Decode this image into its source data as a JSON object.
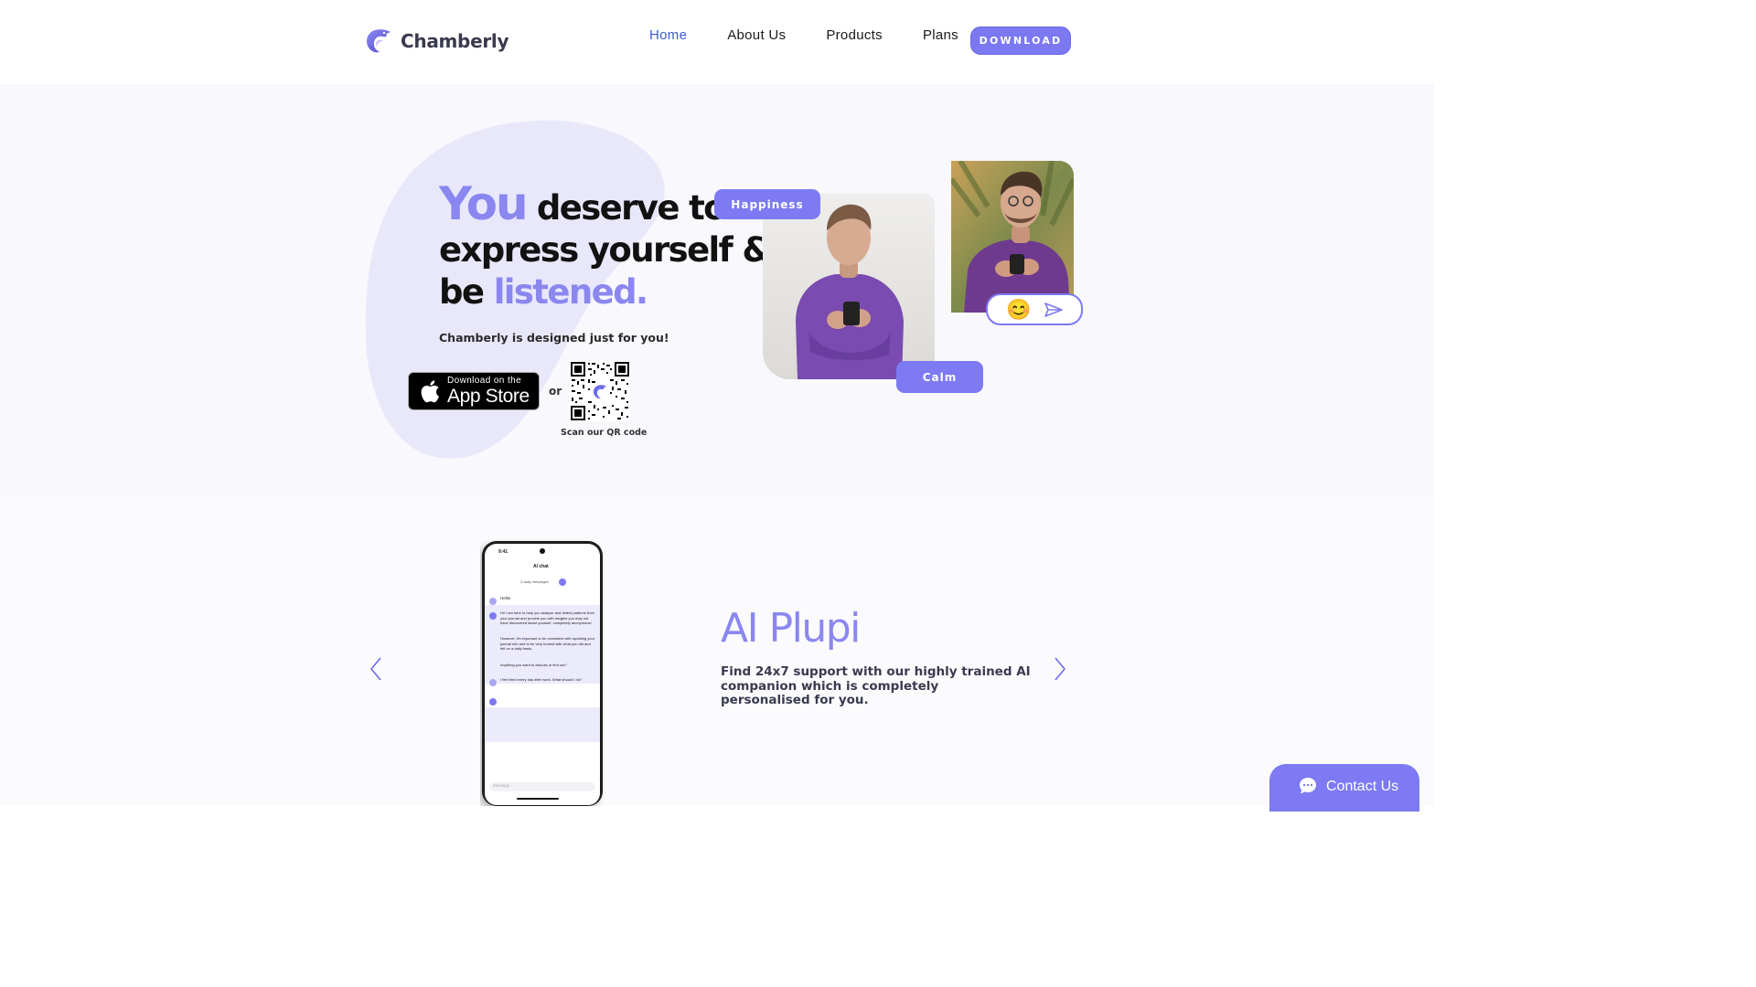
{
  "brand": {
    "name": "Chamberly",
    "logo_icon": "dolphin-logo-icon",
    "accent": "#7d7af3"
  },
  "nav": {
    "items": [
      {
        "label": "Home",
        "active": true
      },
      {
        "label": "About Us",
        "active": false
      },
      {
        "label": "Products",
        "active": false
      },
      {
        "label": "Plans",
        "active": false
      }
    ],
    "download_label": "DOWNLOAD"
  },
  "hero": {
    "headline_you": "You",
    "headline_line1_rest": "deserve to",
    "headline_line2": "express yourself &",
    "headline_line3_start": "be",
    "headline_line3_accent": "listened.",
    "subtitle": "Chamberly is designed just for you!",
    "appstore_small": "Download on the",
    "appstore_big": "App Store",
    "or": "or",
    "qr_caption": "Scan our QR code",
    "tags": {
      "happiness": "Happiness",
      "calm": "Calm"
    },
    "chat_emoji": "😊"
  },
  "feature": {
    "title": "AI Plupi",
    "description": "Find 24x7 support with our highly trained AI companion which is completely personalised for you.",
    "phone": {
      "time": "9:41",
      "header": "AI chat",
      "daily": "3 daily messages",
      "msg1": "Hello!",
      "msg2": "Hi! I am here to help you analyse and detect patterns from your journal and provide you with insights you may not have discovered about yourself, completely anonymous!",
      "msg3": "However, it's important to be consistent with updating your journal info and to be very honest with what you did and felt on a daily basis.",
      "msg4": "Anything you want to discuss or find out?",
      "msg5": "I feel tired every day after work. What should I do?",
      "input_placeholder": "Message..."
    }
  },
  "contact": {
    "label": "Contact Us",
    "icon": "chat-bubble-icon"
  }
}
